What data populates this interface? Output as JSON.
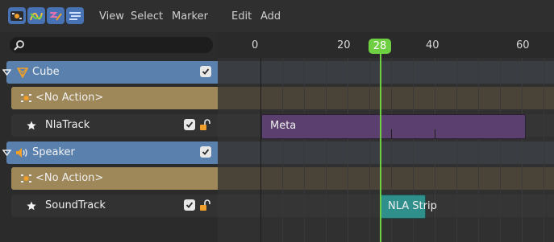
{
  "header": {
    "menus": [
      "View",
      "Select",
      "Marker",
      "Edit",
      "Add"
    ],
    "editor_icons": [
      "nla-editor-icon",
      "graph-editor-icon",
      "drivers-icon",
      "dope-sheet-icon"
    ]
  },
  "search": {
    "placeholder": ""
  },
  "channels": {
    "cube": {
      "label": "Cube",
      "checked": true
    },
    "cube_action": {
      "label": "<No Action>"
    },
    "nla_track": {
      "label": "NlaTrack",
      "checked": true,
      "locked": false
    },
    "speaker": {
      "label": "Speaker",
      "checked": true
    },
    "speaker_action": {
      "label": "<No Action>"
    },
    "sound_track": {
      "label": "SoundTrack",
      "checked": true,
      "locked": false
    }
  },
  "timeline": {
    "ruler_labels": [
      "0",
      "20",
      "40",
      "60"
    ],
    "current_frame": "28",
    "strips": {
      "meta": {
        "label": "Meta"
      },
      "nla": {
        "label": "NLA Strip"
      }
    }
  },
  "colors": {
    "object_row": "#5a80ad",
    "action_row": "#9e8759",
    "playhead": "#6fcf42",
    "meta_strip": "#5a3f6f",
    "nla_strip": "#2f8f8b"
  }
}
